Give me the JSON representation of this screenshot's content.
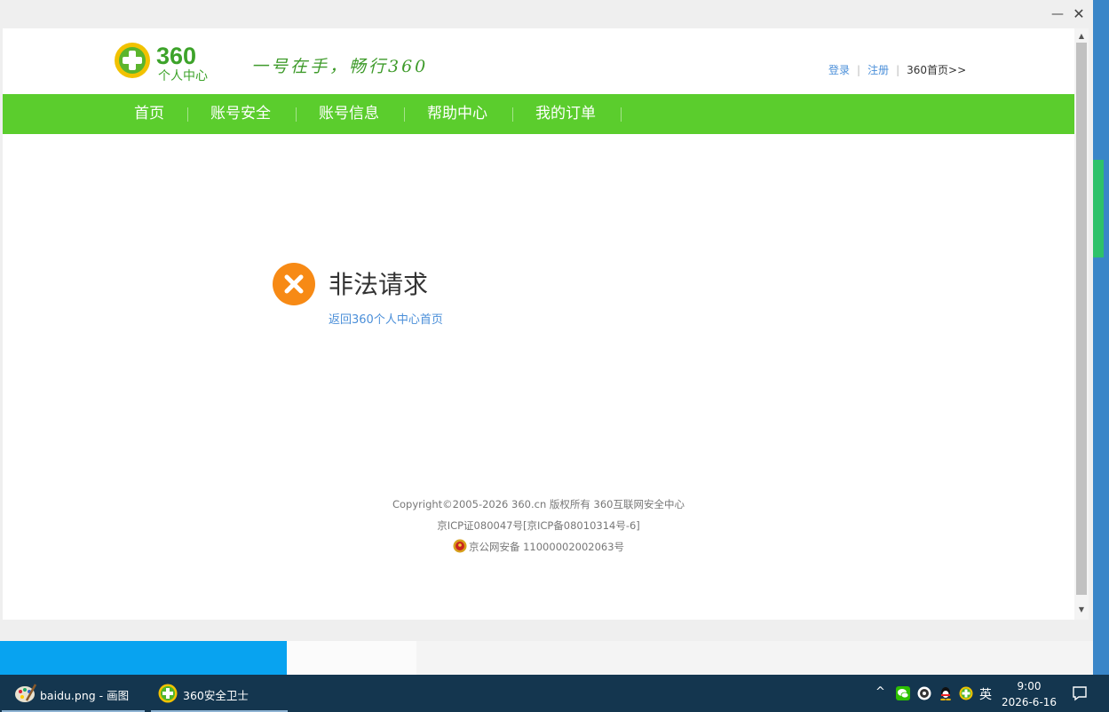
{
  "window": {
    "minimize_glyph": "—",
    "close_glyph": "✕"
  },
  "header": {
    "logo_number": "360",
    "logo_subtitle": "个人中心",
    "slogan": "一号在手，畅行360",
    "links": {
      "login": "登录",
      "register": "注册",
      "home": "360首页>>",
      "separator": "|"
    }
  },
  "nav": {
    "items": [
      "首页",
      "账号安全",
      "账号信息",
      "帮助中心",
      "我的订单"
    ]
  },
  "error": {
    "title": "非法请求",
    "back_link": "返回360个人中心首页"
  },
  "footer": {
    "copyright": "Copyright©2005-2026 360.cn 版权所有 360互联网安全中心",
    "icp": "京ICP证080047号[京ICP备08010314号-6]",
    "police": "京公网安备 11000002002063号"
  },
  "taskbar": {
    "items": [
      {
        "label": "baidu.png - 画图",
        "icon": "paint-icon"
      },
      {
        "label": "360安全卫士",
        "icon": "360-safe-icon"
      }
    ],
    "tray_chevron": "^",
    "language": "英",
    "time": "9:00",
    "date": "2026-6-16"
  },
  "colors": {
    "nav_green": "#5bcd2d",
    "error_orange": "#f78a15",
    "link_blue": "#4b8fd9",
    "taskbar": "#14364f"
  }
}
